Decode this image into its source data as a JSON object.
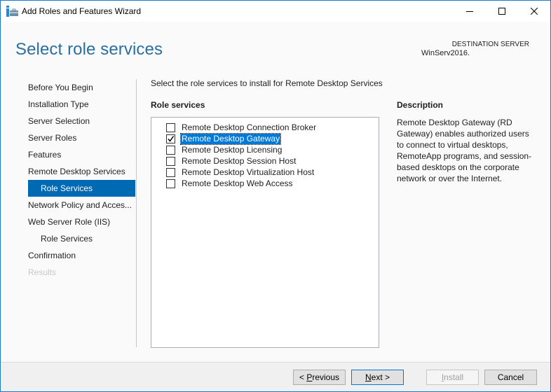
{
  "window": {
    "title": "Add Roles and Features Wizard",
    "controls": {
      "minimize": "minimize",
      "maximize": "maximize",
      "close": "close"
    }
  },
  "header": {
    "page_title": "Select role services",
    "destination_label": "DESTINATION SERVER",
    "destination_server": "WinServ2016."
  },
  "nav": {
    "items": [
      {
        "label": "Before You Begin",
        "state": "normal",
        "indent": false
      },
      {
        "label": "Installation Type",
        "state": "normal",
        "indent": false
      },
      {
        "label": "Server Selection",
        "state": "normal",
        "indent": false
      },
      {
        "label": "Server Roles",
        "state": "normal",
        "indent": false
      },
      {
        "label": "Features",
        "state": "normal",
        "indent": false
      },
      {
        "label": "Remote Desktop Services",
        "state": "normal",
        "indent": false
      },
      {
        "label": "Role Services",
        "state": "active",
        "indent": true
      },
      {
        "label": "Network Policy and Acces...",
        "state": "normal",
        "indent": false
      },
      {
        "label": "Web Server Role (IIS)",
        "state": "normal",
        "indent": false
      },
      {
        "label": "Role Services",
        "state": "normal",
        "indent": true
      },
      {
        "label": "Confirmation",
        "state": "normal",
        "indent": false
      },
      {
        "label": "Results",
        "state": "disabled",
        "indent": false
      }
    ]
  },
  "main": {
    "instruction": "Select the role services to install for Remote Desktop Services",
    "role_services_heading": "Role services",
    "role_services": [
      {
        "label": "Remote Desktop Connection Broker",
        "checked": false,
        "selected": false
      },
      {
        "label": "Remote Desktop Gateway",
        "checked": true,
        "selected": true
      },
      {
        "label": "Remote Desktop Licensing",
        "checked": false,
        "selected": false
      },
      {
        "label": "Remote Desktop Session Host",
        "checked": false,
        "selected": false
      },
      {
        "label": "Remote Desktop Virtualization Host",
        "checked": false,
        "selected": false
      },
      {
        "label": "Remote Desktop Web Access",
        "checked": false,
        "selected": false
      }
    ],
    "description_heading": "Description",
    "description": "Remote Desktop Gateway (RD Gateway) enables authorized users to connect to virtual desktops, RemoteApp programs, and session-based desktops on the corporate network or over the Internet."
  },
  "footer": {
    "previous": {
      "prefix": "< ",
      "accel": "P",
      "rest": "revious"
    },
    "next": {
      "prefix": "",
      "accel": "N",
      "rest": "ext >"
    },
    "install": {
      "prefix": "",
      "accel": "I",
      "rest": "nstall"
    },
    "cancel": "Cancel"
  },
  "colors": {
    "accent": "#0069b4",
    "title_blue": "#2b6f9e",
    "window_border": "#1979ca"
  }
}
